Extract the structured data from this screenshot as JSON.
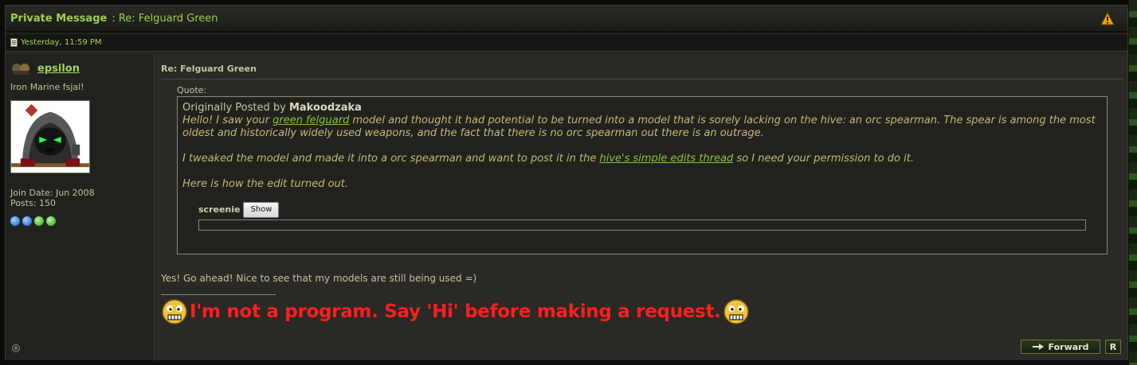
{
  "titlebar": {
    "label": "Private Message",
    "title": ": Re: Felguard Green",
    "warn_icon": "warning-icon"
  },
  "datebar": {
    "date": "Yesterday, 11:59 PM"
  },
  "user": {
    "name": "epsilon",
    "title": "Iron Marine fsjal!",
    "join_date": "Join Date: Jun 2008",
    "posts": "Posts: 150"
  },
  "post": {
    "title": "Re: Felguard Green",
    "quote_label": "Quote:",
    "quote": {
      "by_prefix": "Originally Posted by ",
      "author": "Makoodzaka",
      "p1_a": "Hello! I saw your ",
      "p1_link": "green felguard",
      "p1_b": " model and thought it had potential to be turned into a model that is sorely lacking on the hive: an orc spearman. The spear is among the most oldest and historically widely used weapons, and the fact that there is no orc spearman out there is an outrage.",
      "p2_a": "I tweaked the model and made it into a orc spearman and want to post it in the ",
      "p2_link": "hive's simple edits thread",
      "p2_b": " so I need your permission to do it.",
      "p3": "Here is how the edit turned out.",
      "spoiler_label": "screenie",
      "show_label": "Show"
    },
    "reply": "Yes! Go ahead! Nice to see that my models are still being used =)",
    "signature": "I'm not a program. Say 'Hi' before making a request."
  },
  "buttons": {
    "forward": "Forward",
    "reply_short": "R"
  }
}
